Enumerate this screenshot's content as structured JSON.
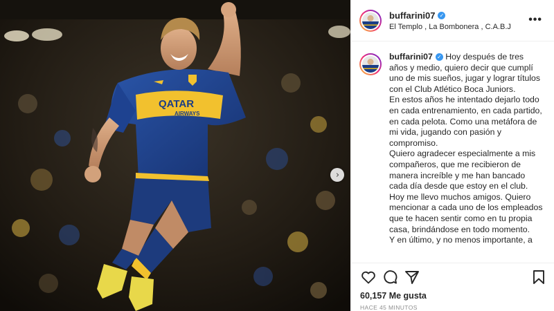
{
  "post": {
    "username": "buffarini07",
    "verified": true,
    "location": "El Templo , La Bombonera , C.A.B.J",
    "more_label": "•••",
    "caption": [
      "Hoy después de tres años y medio, quiero decir que cumplí uno de mis sueños, jugar y lograr títulos con el Club Atlético Boca Juniors.",
      "En estos años he intentado dejarlo todo en cada entrenamiento, en cada partido, en cada pelota. Como una metáfora de mi vida, jugando con pasión y compromiso.",
      "Quiero agradecer especialmente a mis compañeros, que me recibieron de manera increíble y me han bancado cada día desde que estoy en el club.",
      "Hoy me llevo muchos amigos. Quiero mencionar a cada uno de los empleados que te hacen sentir como en tu propia casa, brindándose en todo momento.",
      "Y en último, y no menos importante, a"
    ],
    "likes_text": "60,157 Me gusta",
    "timestamp": "HACE 45 MINUTOS",
    "carousel_next": "›",
    "icons": {
      "like": "heart-icon",
      "comment": "comment-icon",
      "share": "share-icon",
      "save": "bookmark-icon",
      "verified": "verified-badge-icon"
    },
    "jersey_sponsor": {
      "line1": "QATAR",
      "line2": "AIRWAYS"
    },
    "colors": {
      "boca_blue": "#1b3d86",
      "boca_gold": "#f2c12e",
      "verified_blue": "#3897f0",
      "muted_text": "#8e8e8e"
    }
  }
}
